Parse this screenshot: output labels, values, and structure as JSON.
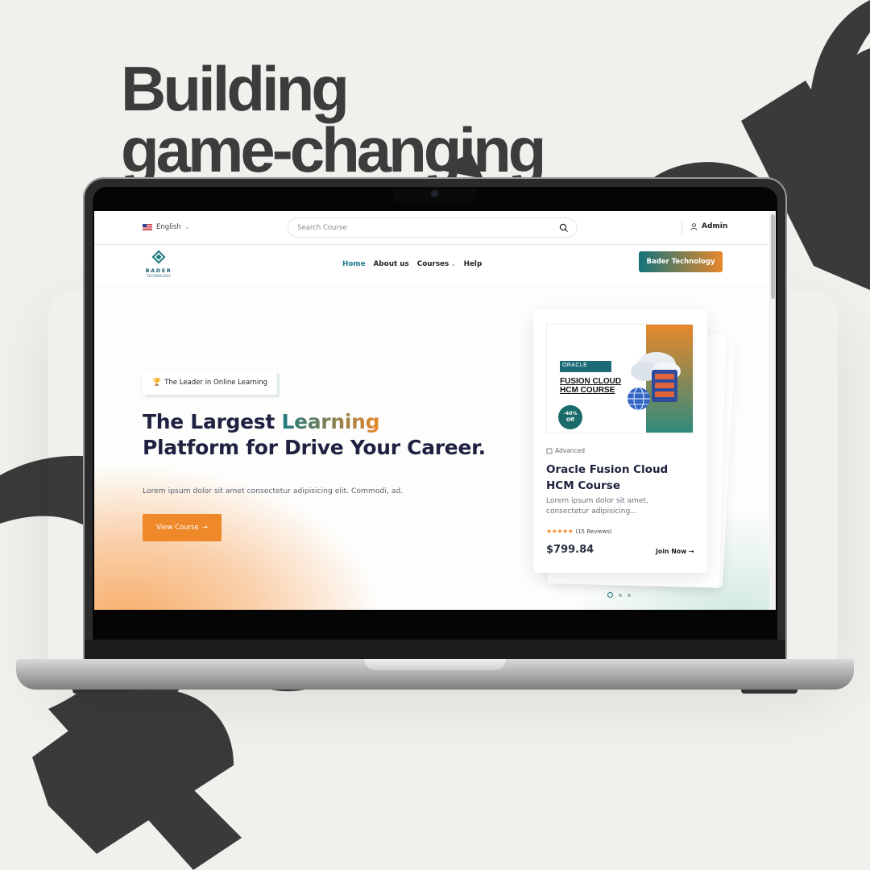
{
  "headline": {
    "line1": "Building",
    "line2": "game-changing"
  },
  "topbar": {
    "language": "English",
    "search_placeholder": "Search Course",
    "user": "Admin"
  },
  "navbar": {
    "logo_name": "BADER",
    "logo_sub": "TECHNOLOGY",
    "items": [
      {
        "label": "Home",
        "active": true
      },
      {
        "label": "About us",
        "active": false
      },
      {
        "label": "Courses",
        "active": false
      },
      {
        "label": "Help",
        "active": false
      }
    ],
    "cta_label": "Bader Technology"
  },
  "hero": {
    "badge": "The Leader in Online Learning",
    "title_part1": "The Largest ",
    "title_highlight": "Learning",
    "title_line2": "Platform for Drive Your Career.",
    "description": "Lorem ipsum dolor sit amet consectetur adipisicing elit. Commodi, ad.",
    "button_label": "View Course",
    "button_arrow": "→"
  },
  "course_card": {
    "image_tag": "ORACLE",
    "image_title_line1": "FUSION CLOUD",
    "image_title_line2": "HCM COURSE",
    "discount_line1": "-40%",
    "discount_line2": "Off",
    "level": "Advanced",
    "title": "Oracle Fusion Cloud HCM Course",
    "description": "Lorem ipsum dolor sit amet, consectetur adipisicing...",
    "stars": "★★★★★",
    "reviews": "(15 Reviews)",
    "price": "$799.84",
    "join_label": "Join Now",
    "join_arrow": "→"
  },
  "carousel": {
    "active_index": 0,
    "count": 3
  },
  "colors": {
    "brand_teal": "#1c7a80",
    "brand_orange": "#ee8828",
    "background": "#f1f0ec",
    "shape_dark": "#3a3a3a"
  }
}
